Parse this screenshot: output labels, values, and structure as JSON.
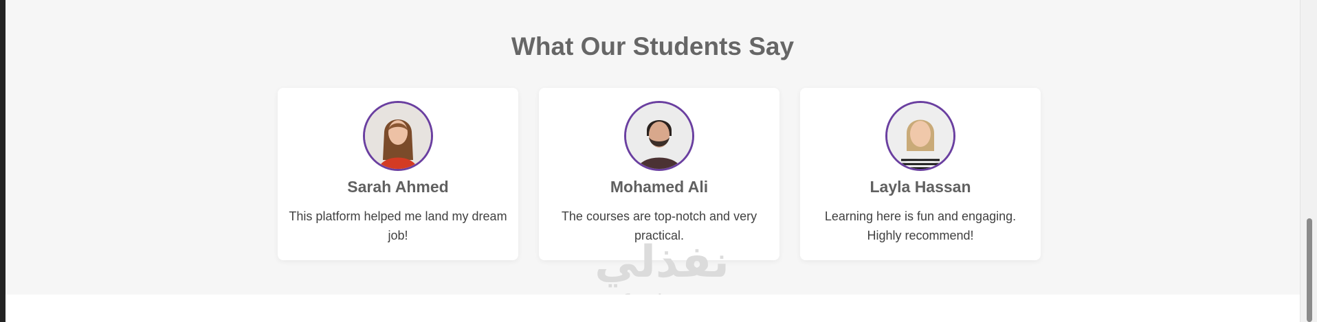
{
  "section": {
    "title": "What Our Students Say"
  },
  "testimonials": [
    {
      "name": "Sarah Ahmed",
      "quote": "This platform helped me land my dream job!",
      "avatar": "woman-red-top-avatar"
    },
    {
      "name": "Mohamed Ali",
      "quote": "The courses are top-notch and very practical.",
      "avatar": "man-beard-avatar"
    },
    {
      "name": "Layla Hassan",
      "quote": "Learning here is fun and engaging. Highly recommend!",
      "avatar": "woman-striped-top-avatar"
    }
  ],
  "watermark": {
    "arabic": "نفذلي",
    "latin": "nafezly.com"
  },
  "colors": {
    "avatar_border": "#6a3fa0",
    "heading": "#666666",
    "section_bg": "#f6f6f6",
    "card_bg": "#ffffff"
  }
}
